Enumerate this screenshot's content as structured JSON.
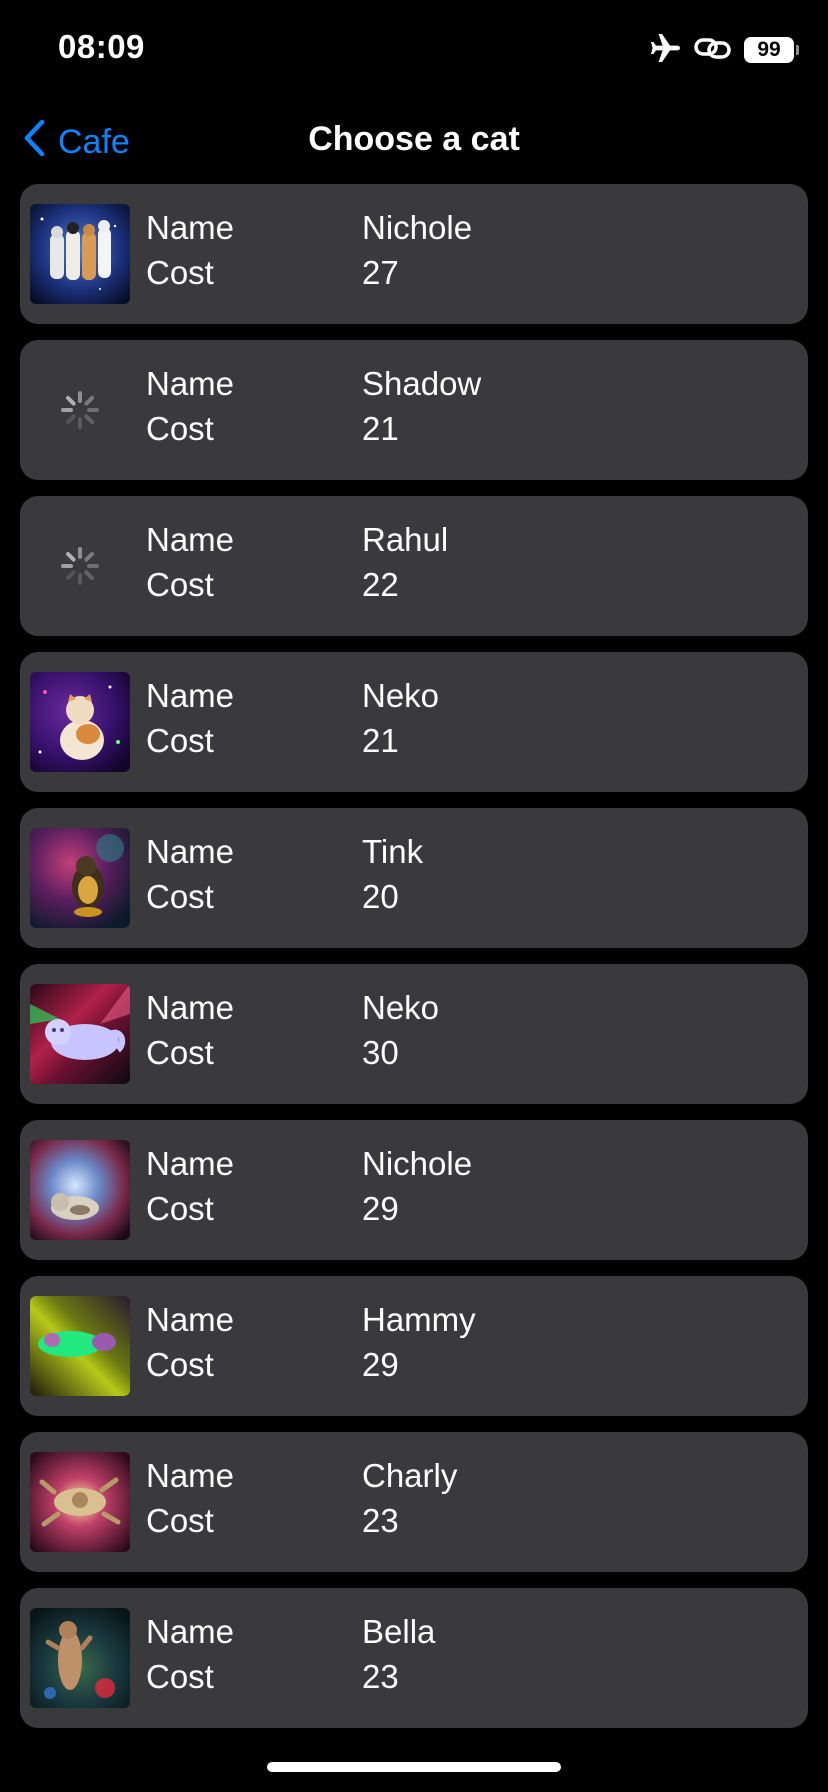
{
  "status_bar": {
    "time": "08:09",
    "battery": "99",
    "icons": [
      "airplane-icon",
      "link-icon",
      "battery-icon"
    ]
  },
  "nav": {
    "back_label": "Cafe",
    "title": "Choose a cat"
  },
  "colors": {
    "background": "#000000",
    "row_background": "#3a3a3c",
    "accent": "#0a84ff",
    "text": "#ffffff"
  },
  "rows": [
    {
      "name_label": "Name",
      "cost_label": "Cost",
      "name": "Nichole",
      "cost": "27",
      "image": "loaded"
    },
    {
      "name_label": "Name",
      "cost_label": "Cost",
      "name": "Shadow",
      "cost": "21",
      "image": "loading"
    },
    {
      "name_label": "Name",
      "cost_label": "Cost",
      "name": "Rahul",
      "cost": "22",
      "image": "loading"
    },
    {
      "name_label": "Name",
      "cost_label": "Cost",
      "name": "Neko",
      "cost": "21",
      "image": "loaded"
    },
    {
      "name_label": "Name",
      "cost_label": "Cost",
      "name": "Tink",
      "cost": "20",
      "image": "loaded"
    },
    {
      "name_label": "Name",
      "cost_label": "Cost",
      "name": "Neko",
      "cost": "30",
      "image": "loaded"
    },
    {
      "name_label": "Name",
      "cost_label": "Cost",
      "name": "Nichole",
      "cost": "29",
      "image": "loaded"
    },
    {
      "name_label": "Name",
      "cost_label": "Cost",
      "name": "Hammy",
      "cost": "29",
      "image": "loaded"
    },
    {
      "name_label": "Name",
      "cost_label": "Cost",
      "name": "Charly",
      "cost": "23",
      "image": "loaded"
    },
    {
      "name_label": "Name",
      "cost_label": "Cost",
      "name": "Bella",
      "cost": "23",
      "image": "loaded"
    }
  ]
}
